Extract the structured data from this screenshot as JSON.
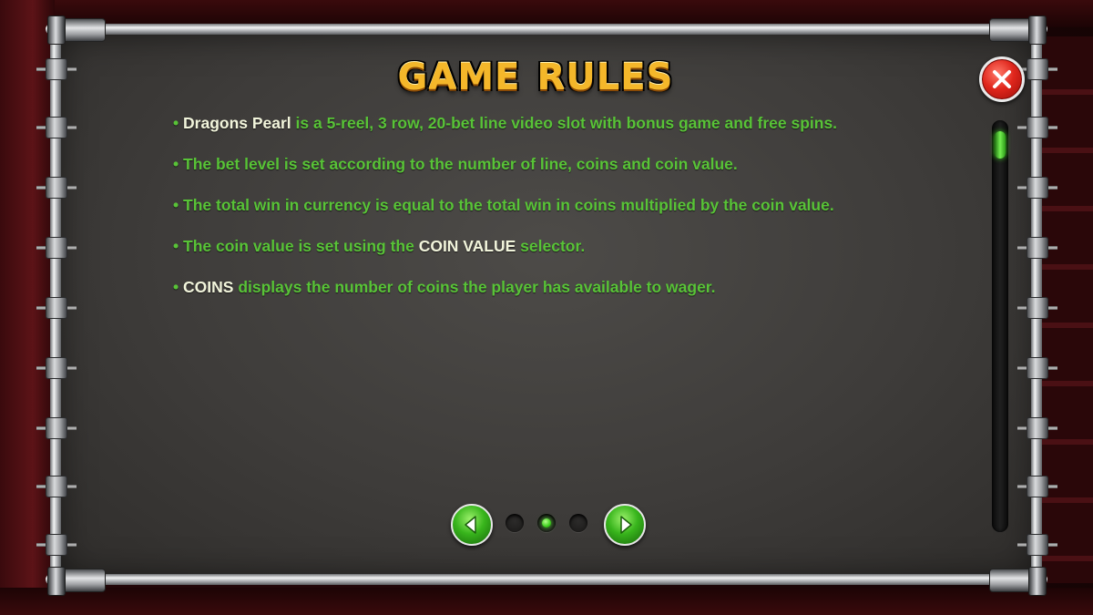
{
  "title": {
    "word1": "GAME",
    "word2": "RULES"
  },
  "close_button": {
    "icon": "close-x-icon",
    "color": "#e0261c"
  },
  "rules": [
    {
      "highlight": "Dragons Pearl",
      "text": " is a 5-reel, 3 row, 20-bet line video slot with bonus game and free spins."
    },
    {
      "pre": "The bet level is set according to the number of line, coins and coin value."
    },
    {
      "pre": "The total win in currency is equal to the total win in coins multiplied by the coin value."
    },
    {
      "pre": "The coin value is set using the ",
      "highlight": "COIN VALUE",
      "post": " selector."
    },
    {
      "highlight": "COINS",
      "text": " displays the number of coins the player has available to wager."
    }
  ],
  "bullet": "•",
  "pagination": {
    "current_page": 2,
    "total_pages": 3,
    "prev_icon": "arrow-left-icon",
    "next_icon": "arrow-right-icon"
  },
  "scroll": {
    "position": 0
  },
  "colors": {
    "rule_text": "#58c337",
    "highlight_text": "#f2f5dc",
    "title": "#f4b72a",
    "accent_green": "#38b51c"
  }
}
